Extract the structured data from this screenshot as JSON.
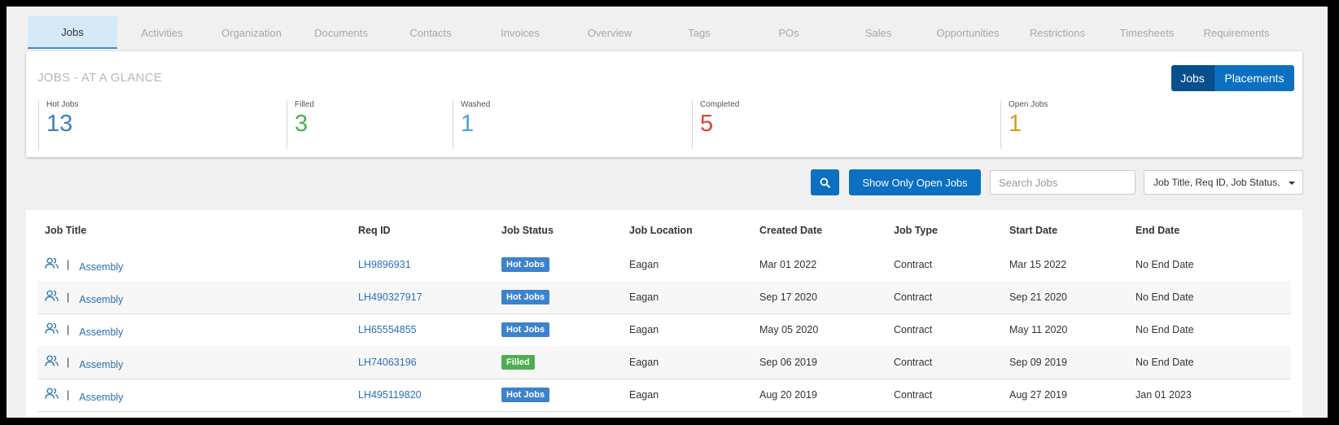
{
  "tabs": [
    "Jobs",
    "Activities",
    "Organization",
    "Documents",
    "Contacts",
    "Invoices",
    "Overview",
    "Tags",
    "POs",
    "Sales",
    "Opportunities",
    "Restrictions",
    "Timesheets",
    "Requirements"
  ],
  "glance": {
    "title": "JOBS - AT A GLANCE",
    "toggle": {
      "jobs": "Jobs",
      "placements": "Placements"
    },
    "stats": [
      {
        "label": "Hot Jobs",
        "value": "13",
        "color": "#3d7fc4"
      },
      {
        "label": "Filled",
        "value": "3",
        "color": "#4caf50"
      },
      {
        "label": "Washed",
        "value": "1",
        "color": "#4aa3df"
      },
      {
        "label": "Completed",
        "value": "5",
        "color": "#d9443a"
      },
      {
        "label": "Open Jobs",
        "value": "1",
        "color": "#d4a017"
      }
    ]
  },
  "search": {
    "open_jobs_label": "Show Only Open Jobs",
    "placeholder": "Search Jobs",
    "filter_value": "Job Title, Req ID, Job Status,"
  },
  "table": {
    "headers": [
      "Job Title",
      "Req ID",
      "Job Status",
      "Job Location",
      "Created Date",
      "Job Type",
      "Start Date",
      "End Date"
    ],
    "rows": [
      {
        "title": "Assembly",
        "req": "LH9896931",
        "status": "Hot Jobs",
        "location": "Eagan",
        "created": "Mar 01 2022",
        "type": "Contract",
        "start": "Mar 15 2022",
        "end": "No End Date"
      },
      {
        "title": "Assembly",
        "req": "LH490327917",
        "status": "Hot Jobs",
        "location": "Eagan",
        "created": "Sep 17 2020",
        "type": "Contract",
        "start": "Sep 21 2020",
        "end": "No End Date"
      },
      {
        "title": "Assembly",
        "req": "LH65554855",
        "status": "Hot Jobs",
        "location": "Eagan",
        "created": "May 05 2020",
        "type": "Contract",
        "start": "May 11 2020",
        "end": "No End Date"
      },
      {
        "title": "Assembly",
        "req": "LH74063196",
        "status": "Filled",
        "location": "Eagan",
        "created": "Sep 06 2019",
        "type": "Contract",
        "start": "Sep 09 2019",
        "end": "No End Date"
      },
      {
        "title": "Assembly",
        "req": "LH495119820",
        "status": "Hot Jobs",
        "location": "Eagan",
        "created": "Aug 20 2019",
        "type": "Contract",
        "start": "Aug 27 2019",
        "end": "Jan 01 2023"
      }
    ]
  },
  "colors": {
    "hot": "#3d82cc",
    "filled": "#4caf50",
    "primary": "#0b6fc2"
  }
}
